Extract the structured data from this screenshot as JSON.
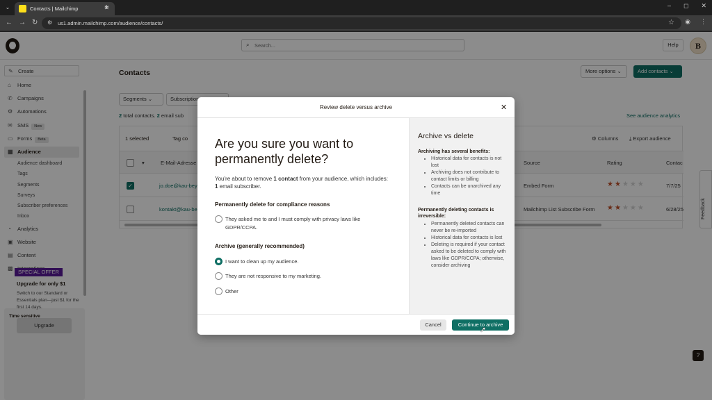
{
  "browser": {
    "tab_title": "Contacts | Mailchimp",
    "url": "us1.admin.mailchimp.com/audience/contacts/",
    "new_tab": "+",
    "window_controls": [
      "–",
      "◻",
      "✕"
    ]
  },
  "topnav": {
    "search_placeholder": "Search...",
    "help_label": "Help",
    "avatar_initial": "B"
  },
  "sidebar": {
    "items": [
      {
        "label": "Create",
        "icon": "pencil-icon"
      },
      {
        "label": "Home",
        "icon": "home-icon"
      },
      {
        "label": "Campaigns",
        "icon": "megaphone-icon"
      },
      {
        "label": "Automations",
        "icon": "automation-icon"
      },
      {
        "label": "SMS",
        "icon": "sms-icon",
        "badge": "New"
      },
      {
        "label": "Forms",
        "icon": "forms-icon",
        "badge": "Beta"
      },
      {
        "label": "Audience",
        "icon": "audience-icon",
        "active": true
      },
      {
        "label": "Analytics",
        "icon": "analytics-icon"
      },
      {
        "label": "Website",
        "icon": "website-icon"
      },
      {
        "label": "Content",
        "icon": "content-icon"
      },
      {
        "label": "Integrations",
        "icon": "integrations-icon"
      }
    ],
    "audience_sub": [
      "Audience dashboard",
      "Tags",
      "Segments",
      "Surveys",
      "Subscriber preferences",
      "Inbox"
    ],
    "promo": {
      "time_sensitive": "Time sensitive",
      "offer": "SPECIAL OFFER",
      "title": "Upgrade for only $1",
      "text": "Switch to our Standard or Essentials plan—just $1 for the first 14 days.",
      "button": "Upgrade"
    }
  },
  "main": {
    "title": "Contacts",
    "more_options": "More options ⌄",
    "add_contacts": "Add contacts ⌄",
    "filters": [
      "Segments ⌄",
      "Subscription"
    ],
    "count_number": "2",
    "count_text": "total contacts.",
    "count_number2": "2",
    "count_text2": "email sub",
    "analytics_link": "See audience analytics",
    "selected": "1 selected",
    "tag_label": "Tag co",
    "columns_label": "Columns",
    "export_label": "Export audience",
    "headers": {
      "email": "E-Mail-Adresse",
      "source": "Source",
      "rating": "Rating",
      "contact": "Contac"
    },
    "rows": [
      {
        "email": "jo.doe@kau-bey",
        "source": "Embed Form",
        "rating": 2,
        "date": "7/7/25",
        "checked": true
      },
      {
        "email": "kontakt@kau-be",
        "source": "Mailchimp List Subscribe Form",
        "rating": 2,
        "date": "6/28/25",
        "checked": false
      }
    ],
    "feedback": "Feedback",
    "help_q": "?"
  },
  "modal": {
    "title": "Review delete versus archive",
    "close": "✕",
    "heading": "Are you sure you want to permanently delete?",
    "intro_pre": "You're about to remove ",
    "intro_bold1": "1 contact",
    "intro_mid": " from your audience, which includes: ",
    "intro_bold2": "1",
    "intro_post": " email subscriber.",
    "section_compliance": "Permanently delete for compliance reasons",
    "option_privacy": "They asked me to and I must comply with privacy laws like GDPR/CCPA.",
    "section_archive": "Archive (generally recommended)",
    "option_cleanup": "I want to clean up my audience.",
    "option_unresponsive": "They are not responsive to my marketing.",
    "option_other": "Other",
    "selected_option": "I want to clean up my audience.",
    "right_title": "Archive vs delete",
    "archive_sub": "Archiving has several benefits:",
    "archive_points": [
      "Historical data for contacts is not lost",
      "Archiving does not contribute to contact limits or billing",
      "Contacts can be unarchived any time"
    ],
    "delete_sub": "Permanently deleting contacts is irreversible:",
    "delete_points": [
      "Permanently deleted contacts can never be re-imported",
      "Historical data for contacts is lost",
      "Deleting is required if your contact asked to be deleted to comply with laws like GDPR/CCPA; otherwise, consider archiving"
    ],
    "cancel": "Cancel",
    "continue": "Continue to archive"
  },
  "colors": {
    "accent": "#0f6f64",
    "star": "#c0502a",
    "offer": "#5a1a9a"
  }
}
